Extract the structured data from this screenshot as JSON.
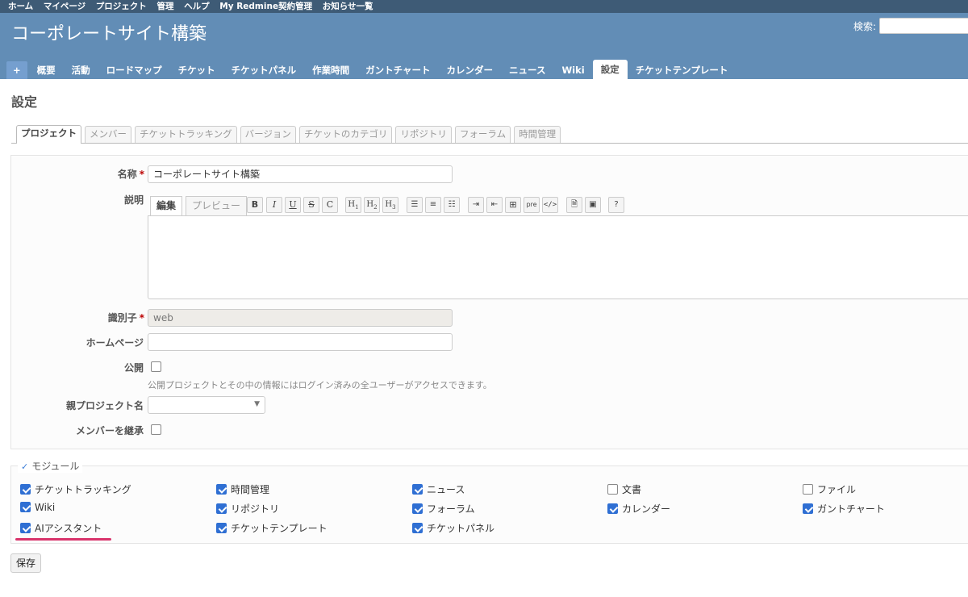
{
  "top_menu": [
    "ホーム",
    "マイページ",
    "プロジェクト",
    "管理",
    "ヘルプ",
    "My Redmine契約管理",
    "お知らせ一覧"
  ],
  "header": {
    "project_title": "コーポレートサイト構築",
    "search_label": "検索:",
    "search_value": ""
  },
  "main_menu": {
    "plus": "+",
    "tabs": [
      "概要",
      "活動",
      "ロードマップ",
      "チケット",
      "チケットパネル",
      "作業時間",
      "ガントチャート",
      "カレンダー",
      "ニュース",
      "Wiki",
      "設定",
      "チケットテンプレート"
    ],
    "selected": "設定"
  },
  "page": {
    "heading": "設定"
  },
  "settings_tabs": [
    "プロジェクト",
    "メンバー",
    "チケットトラッキング",
    "バージョン",
    "チケットのカテゴリ",
    "リポジトリ",
    "フォーラム",
    "時間管理"
  ],
  "form": {
    "name_label": "名称",
    "name_value": "コーポレートサイト構築",
    "required_mark": "*",
    "description_label": "説明",
    "desc_tab_edit": "編集",
    "desc_tab_preview": "プレビュー",
    "toolbar": [
      "B",
      "I",
      "U",
      "S",
      "C",
      "H1",
      "H2",
      "H3",
      "ul",
      "ol",
      "task",
      "indent",
      "outdent",
      "table",
      "pre",
      "code",
      "file",
      "image",
      "help"
    ],
    "identifier_label": "識別子",
    "identifier_value": "web",
    "homepage_label": "ホームページ",
    "homepage_value": "",
    "public_label": "公開",
    "public_checked": false,
    "public_hint": "公開プロジェクトとその中の情報にはログイン済みの全ユーザーがアクセスできます。",
    "parent_label": "親プロジェクト名",
    "parent_value": "",
    "inherit_label": "メンバーを継承",
    "inherit_checked": false
  },
  "modules": {
    "legend": "モジュール",
    "items": [
      {
        "label": "チケットトラッキング",
        "checked": true
      },
      {
        "label": "時間管理",
        "checked": true
      },
      {
        "label": "ニュース",
        "checked": true
      },
      {
        "label": "文書",
        "checked": false
      },
      {
        "label": "ファイル",
        "checked": false
      },
      {
        "label": "Wiki",
        "checked": true
      },
      {
        "label": "リポジトリ",
        "checked": true
      },
      {
        "label": "フォーラム",
        "checked": true
      },
      {
        "label": "カレンダー",
        "checked": true
      },
      {
        "label": "ガントチャート",
        "checked": true
      },
      {
        "label": "AIアシスタント",
        "checked": true
      },
      {
        "label": "チケットテンプレート",
        "checked": true
      },
      {
        "label": "チケットパネル",
        "checked": true
      }
    ]
  },
  "save_label": "保存",
  "colors": {
    "header_bg": "#628db6",
    "top_menu_bg": "#3e5b76",
    "highlight_underline": "#d9336b",
    "required": "#bb0000"
  }
}
